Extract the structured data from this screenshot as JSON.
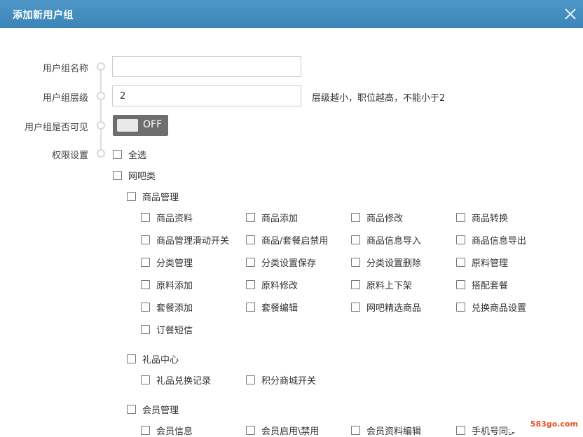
{
  "dialog": {
    "title": "添加新用户组"
  },
  "form": {
    "name_label": "用户组名称",
    "name_value": "",
    "level_label": "用户组层级",
    "level_value": "2",
    "level_hint": "层级越小，职位越高，不能小于2",
    "visible_label": "用户组是否可见",
    "visible_toggle": "OFF",
    "perm_label": "权限设置"
  },
  "permissions": {
    "select_all": "全选",
    "group": "网吧类",
    "goods": {
      "label": "商品管理",
      "items": [
        "商品资料",
        "商品添加",
        "商品修改",
        "商品转换",
        "商品管理滑动开关",
        "商品/套餐启禁用",
        "商品信息导入",
        "商品信息导出",
        "分类管理",
        "分类设置保存",
        "分类设置删除",
        "原料管理",
        "原料添加",
        "原料修改",
        "原料上下架",
        "搭配套餐",
        "套餐添加",
        "套餐编辑",
        "网吧精选商品",
        "兑换商品设置",
        "订餐短信"
      ]
    },
    "gift": {
      "label": "礼品中心",
      "items": [
        "礼品兑换记录",
        "积分商城开关"
      ]
    },
    "member": {
      "label": "会员管理",
      "items": [
        "会员信息",
        "会员启用\\禁用",
        "会员资料编辑",
        "手机号同步"
      ]
    }
  },
  "watermark": "583go.com"
}
